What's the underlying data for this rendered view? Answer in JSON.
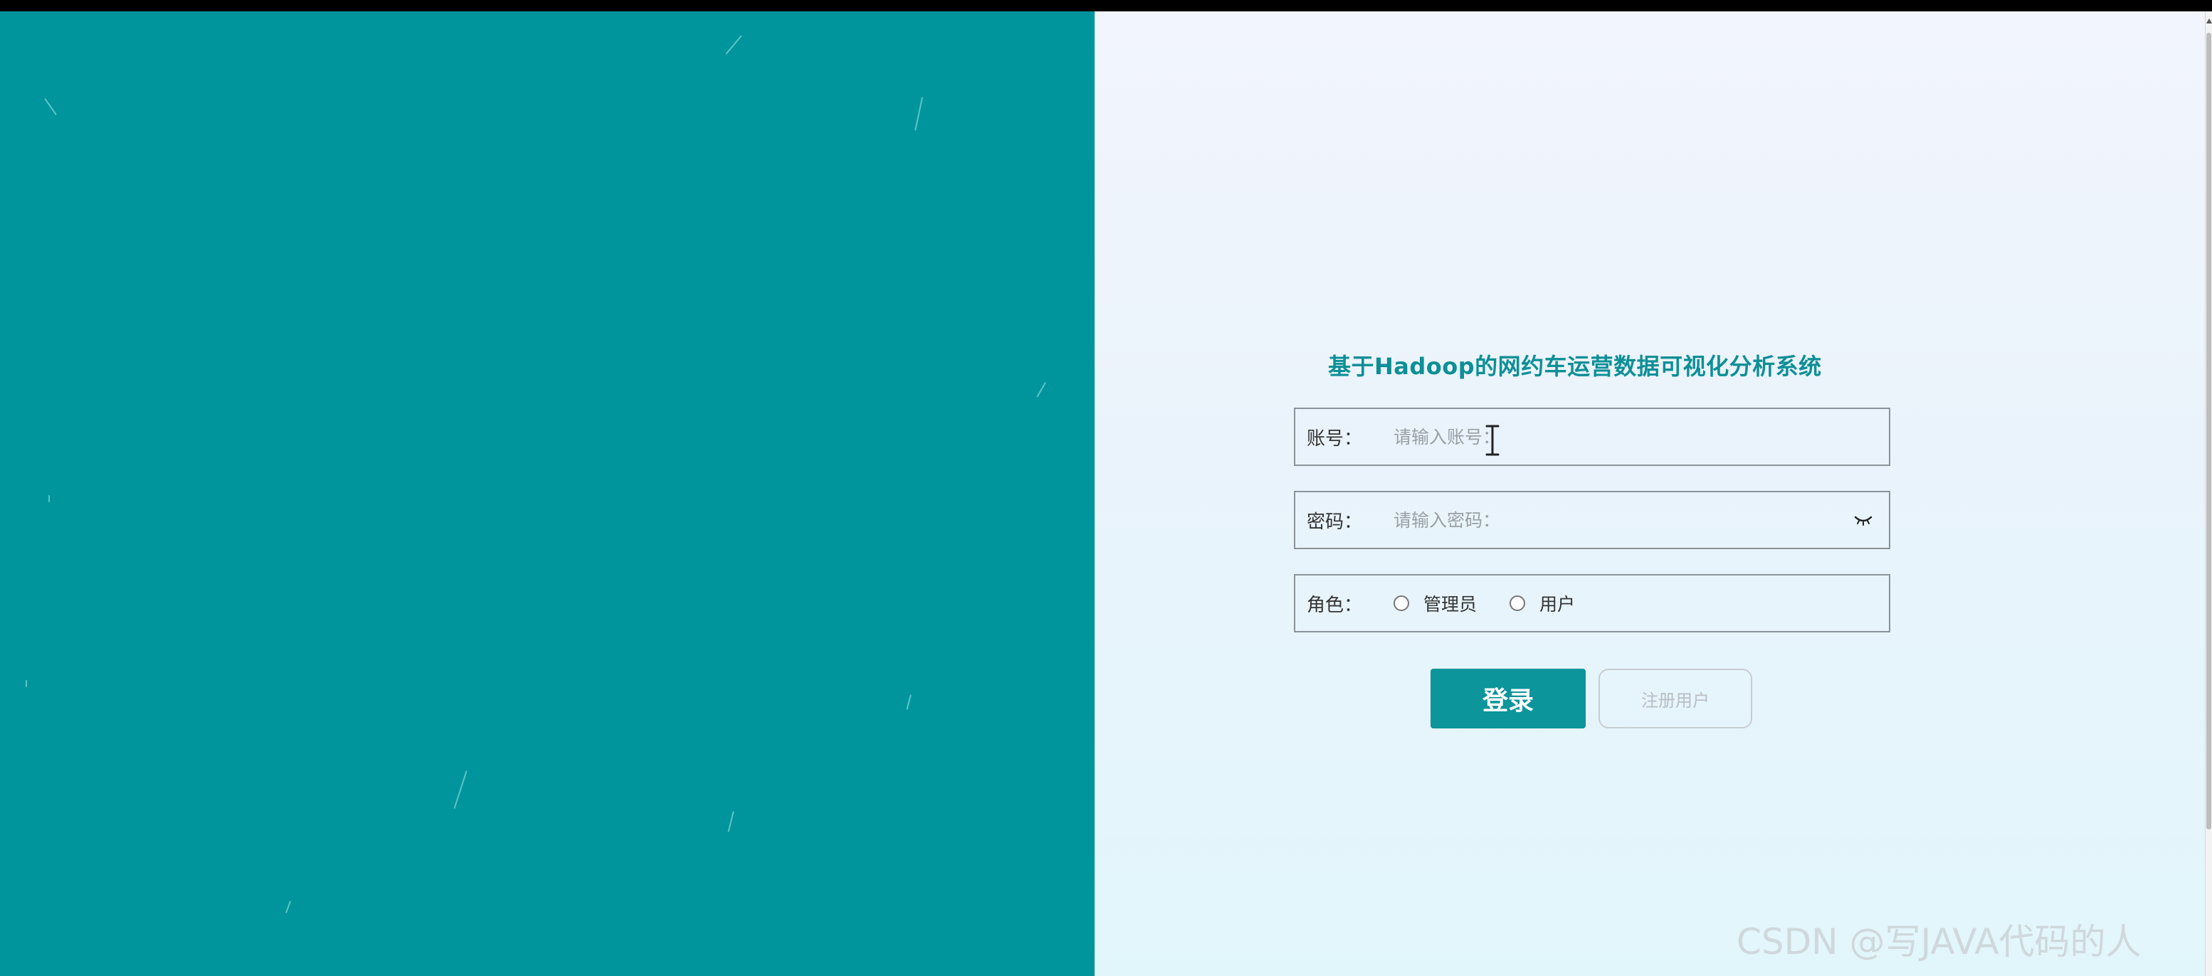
{
  "page": {
    "title": "基于Hadoop的网约车运营数据可视化分析系统"
  },
  "form": {
    "account": {
      "label": "账号：",
      "placeholder": "请输入账号："
    },
    "password": {
      "label": "密码：",
      "placeholder": "请输入密码："
    },
    "role": {
      "label": "角色：",
      "options": [
        "管理员",
        "用户"
      ]
    }
  },
  "buttons": {
    "login_label": "登录",
    "register_label": "注册用户"
  },
  "icons": {
    "password_toggle": "eye-closed-icon",
    "text_cursor": "ibeam-cursor-icon"
  },
  "watermark": "CSDN @写JAVA代码的人",
  "colors": {
    "brand_teal": "#00959c",
    "title_teal": "#0d8f96",
    "button_teal": "#0c959a"
  }
}
